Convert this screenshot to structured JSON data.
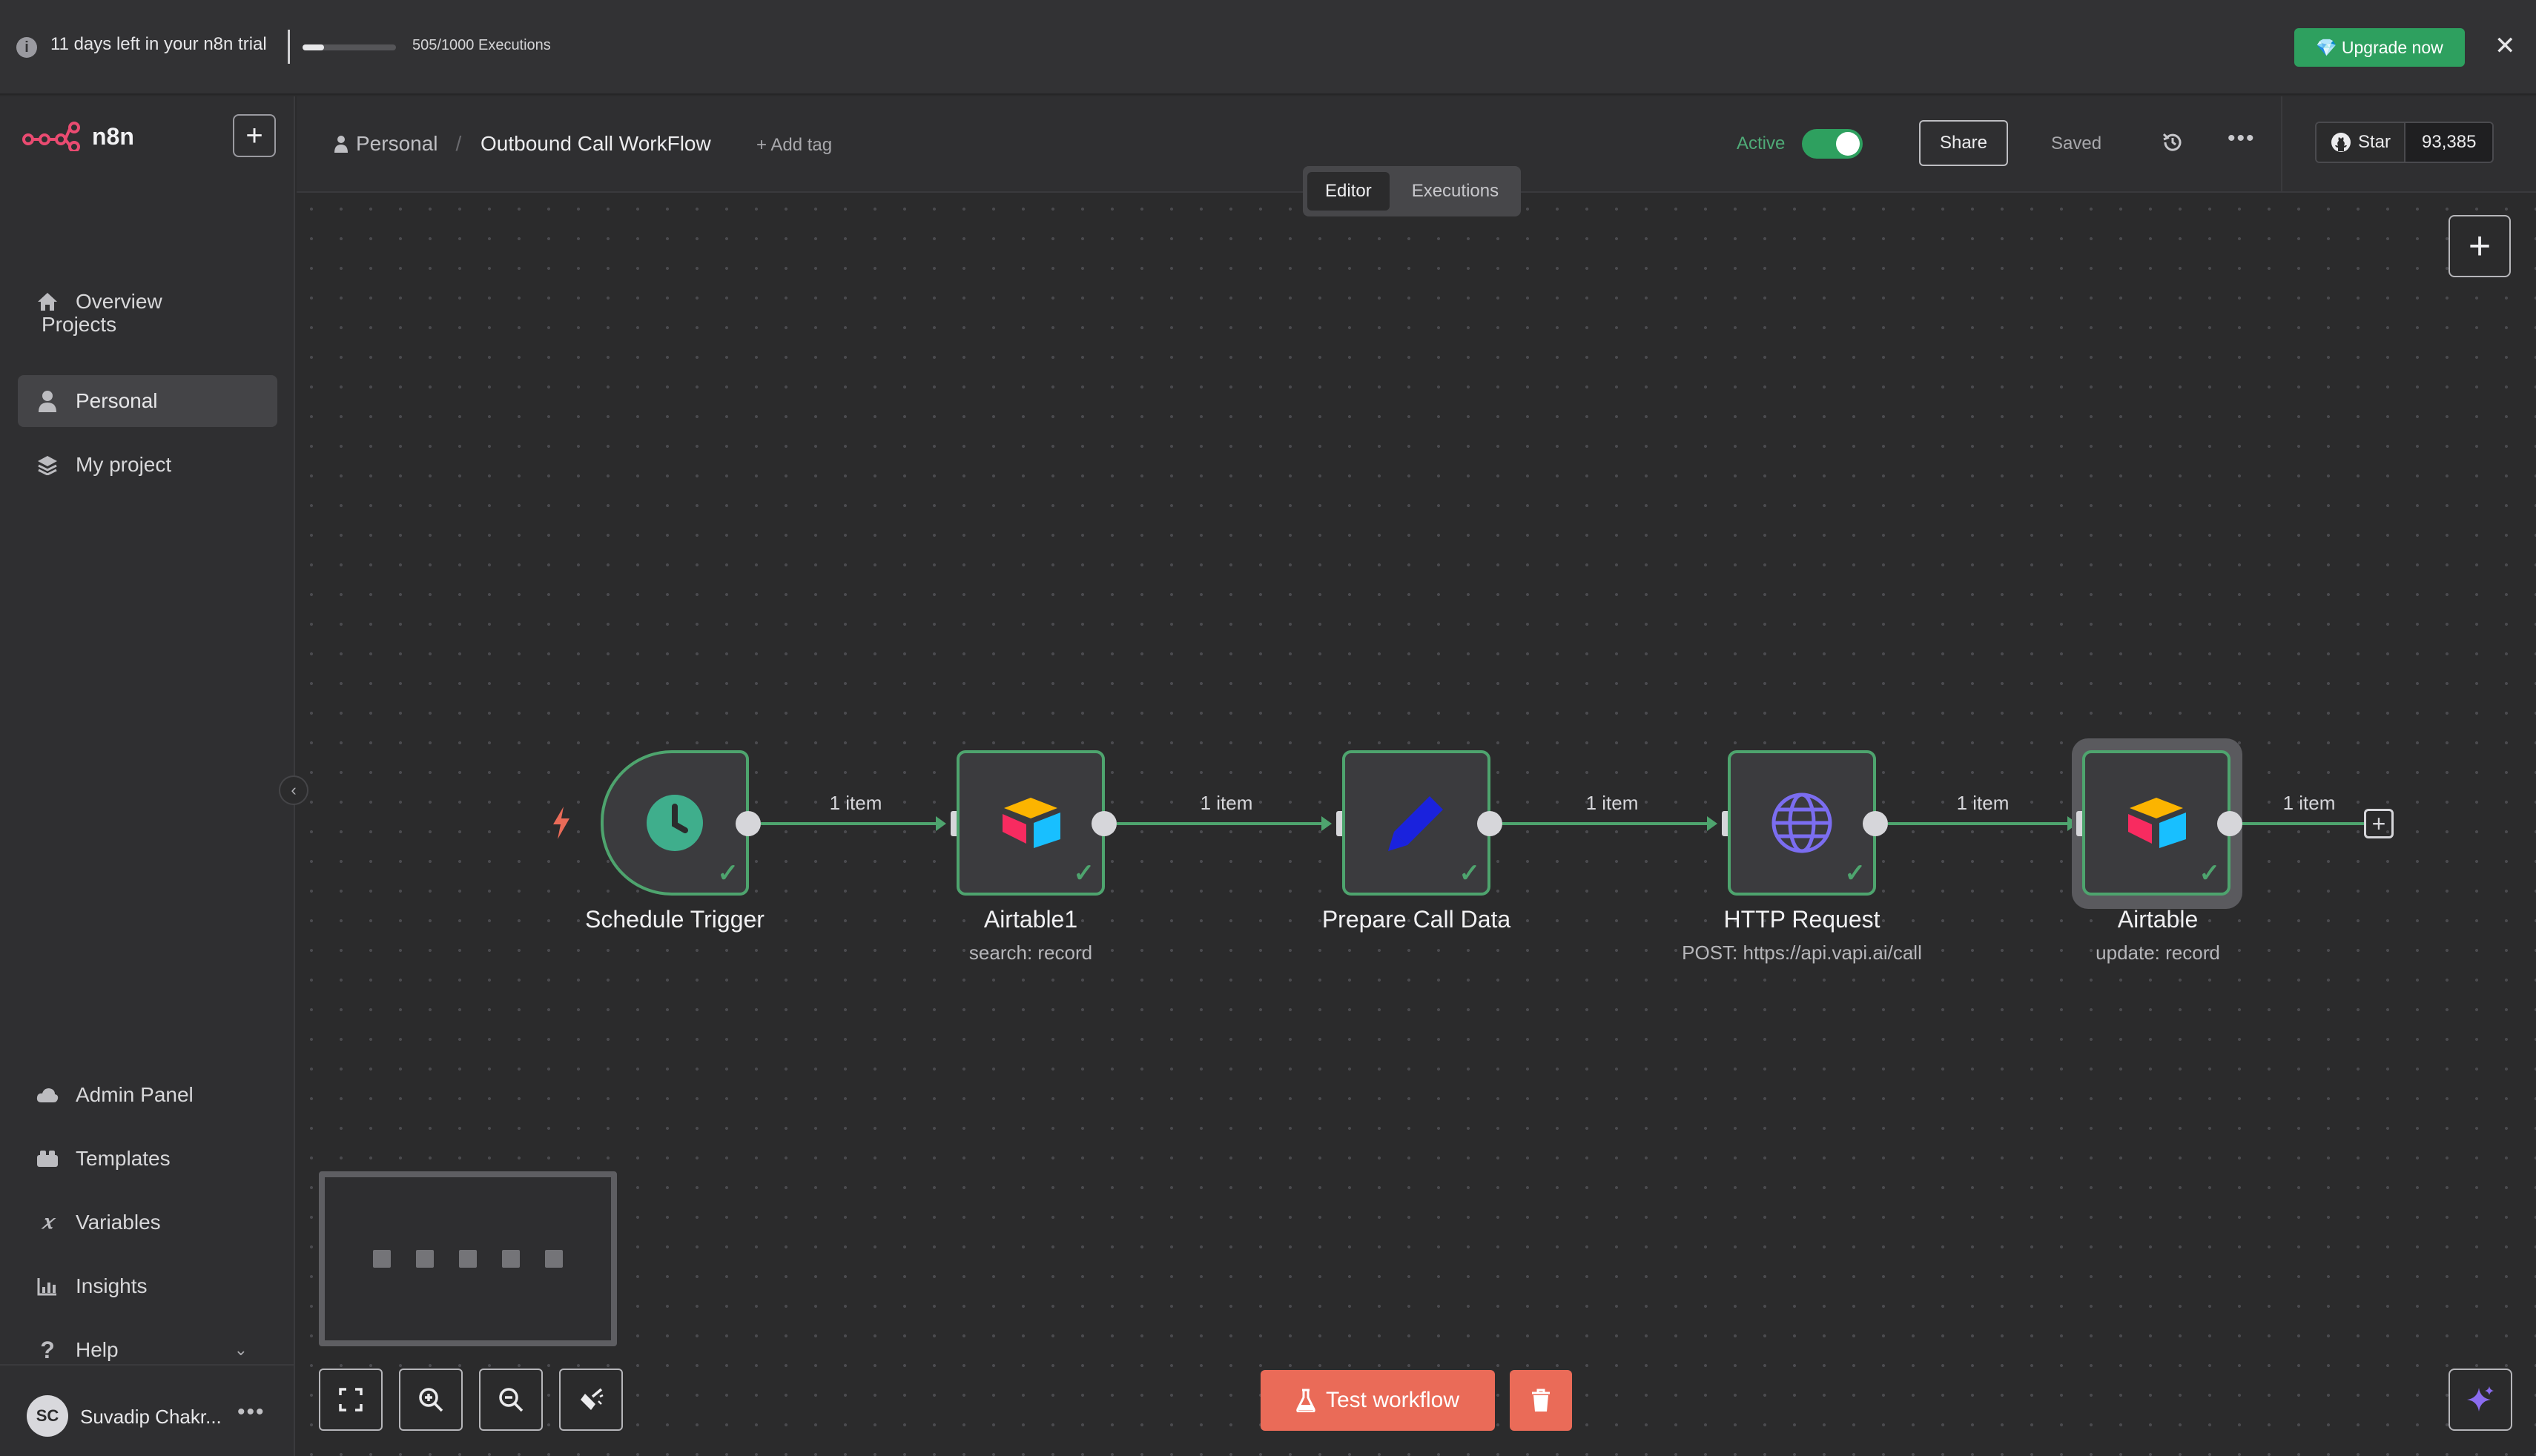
{
  "banner": {
    "trial_text": "11 days left in your n8n trial",
    "executions_text": "505/1000 Executions",
    "executions_used": 505,
    "executions_limit": 1000,
    "upgrade_label": "Upgrade now"
  },
  "sidebar": {
    "logo_text": "n8n",
    "overview_label": "Overview",
    "projects_heading": "Projects",
    "projects": [
      {
        "label": "Personal",
        "icon": "user-icon",
        "active": true
      },
      {
        "label": "My project",
        "icon": "layers-icon",
        "active": false
      }
    ],
    "bottom_items": [
      {
        "label": "Admin Panel",
        "icon": "cloud-icon"
      },
      {
        "label": "Templates",
        "icon": "templates-icon"
      },
      {
        "label": "Variables",
        "icon": "variables-icon"
      },
      {
        "label": "Insights",
        "icon": "insights-icon"
      },
      {
        "label": "Help",
        "icon": "help-icon"
      }
    ],
    "user": {
      "initials": "SC",
      "name": "Suvadip Chakr..."
    }
  },
  "header": {
    "breadcrumb_project": "Personal",
    "workflow_name": "Outbound Call WorkFlow",
    "add_tag_label": "+ Add tag",
    "active_label": "Active",
    "active": true,
    "share_label": "Share",
    "saved_label": "Saved",
    "github_star_label": "Star",
    "github_star_count": "93,385"
  },
  "mode_tabs": [
    {
      "label": "Editor",
      "selected": true
    },
    {
      "label": "Executions",
      "selected": false
    }
  ],
  "workflow": {
    "nodes": [
      {
        "title": "Schedule Trigger",
        "subtitle": "",
        "icon": "clock-icon"
      },
      {
        "title": "Airtable1",
        "subtitle": "search: record",
        "icon": "airtable-icon"
      },
      {
        "title": "Prepare Call Data",
        "subtitle": "",
        "icon": "pencil-icon"
      },
      {
        "title": "HTTP Request",
        "subtitle": "POST: https://api.vapi.ai/call",
        "icon": "globe-icon"
      },
      {
        "title": "Airtable",
        "subtitle": "update: record",
        "icon": "airtable-icon"
      }
    ],
    "edge_labels": [
      "1 item",
      "1 item",
      "1 item",
      "1 item",
      "1 item"
    ]
  },
  "footer": {
    "test_workflow_label": "Test workflow"
  },
  "colors": {
    "accent_green": "#2ea05f",
    "node_border_green": "#4ea46e",
    "test_button": "#ea6b58",
    "canvas_bg": "#2b2b2c"
  }
}
